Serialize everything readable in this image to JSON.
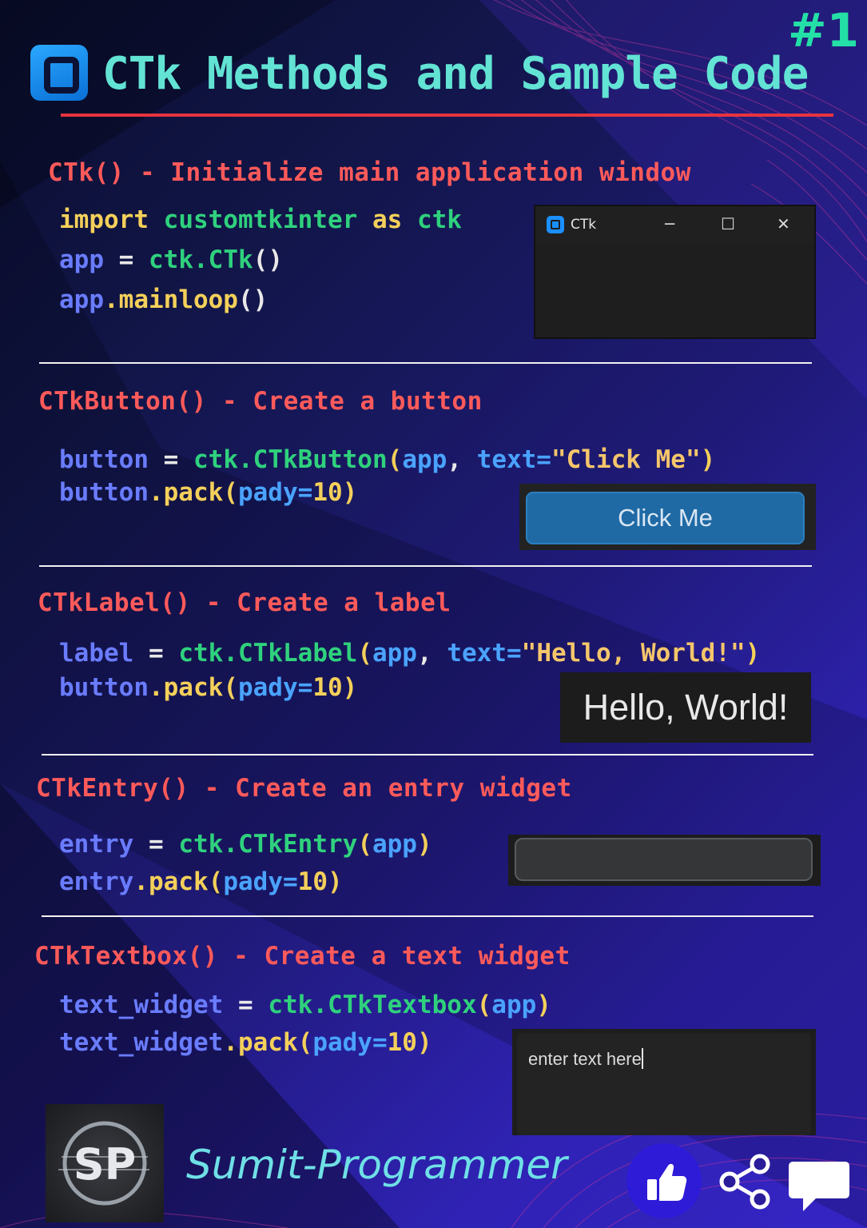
{
  "header": {
    "title": "CTk Methods and Sample Code",
    "tag": "#1"
  },
  "sections": [
    {
      "heading_method": "CTk()",
      "heading_rest": " - Initialize main application window",
      "code": [
        "import customtkinter as ctk",
        "app = ctk.CTk()",
        "app.mainloop()"
      ],
      "preview": {
        "type": "window",
        "window_title": "CTk",
        "minimize": "─",
        "maximize": "☐",
        "close": "✕"
      }
    },
    {
      "heading_method": "CTkButton()",
      "heading_rest": " - Create a button",
      "code": [
        "button = ctk.CTkButton(app, text=\"Click Me\")",
        "button.pack(pady=10)"
      ],
      "preview": {
        "type": "button",
        "label": "Click Me"
      }
    },
    {
      "heading_method": "CTkLabel()",
      "heading_rest": " - Create a label",
      "code": [
        "label = ctk.CTkLabel(app, text=\"Hello, World!\")",
        "button.pack(pady=10)"
      ],
      "preview": {
        "type": "label",
        "label": "Hello, World!"
      }
    },
    {
      "heading_method": "CTkEntry()",
      "heading_rest": " - Create an entry widget",
      "code": [
        "entry = ctk.CTkEntry(app)",
        "entry.pack(pady=10)"
      ],
      "preview": {
        "type": "entry",
        "value": ""
      }
    },
    {
      "heading_method": "CTkTextbox()",
      "heading_rest": " - Create a text widget",
      "code": [
        "text_widget = ctk.CTkTextbox(app)",
        "text_widget.pack(pady=10)"
      ],
      "preview": {
        "type": "textbox",
        "value": "enter text here"
      }
    }
  ],
  "footer": {
    "logo_text": "SP",
    "brand": "Sumit-Programmer",
    "icons": [
      "thumbs-up-icon",
      "share-icon",
      "comment-icon"
    ]
  },
  "colors": {
    "heading": "#ff5a5a",
    "keyword": "#f4d05a",
    "variable": "#6a7cff",
    "module": "#2fd17d",
    "attribute": "#4aa3ff",
    "title": "#62e3d4",
    "accent_line": "#e8333f"
  }
}
